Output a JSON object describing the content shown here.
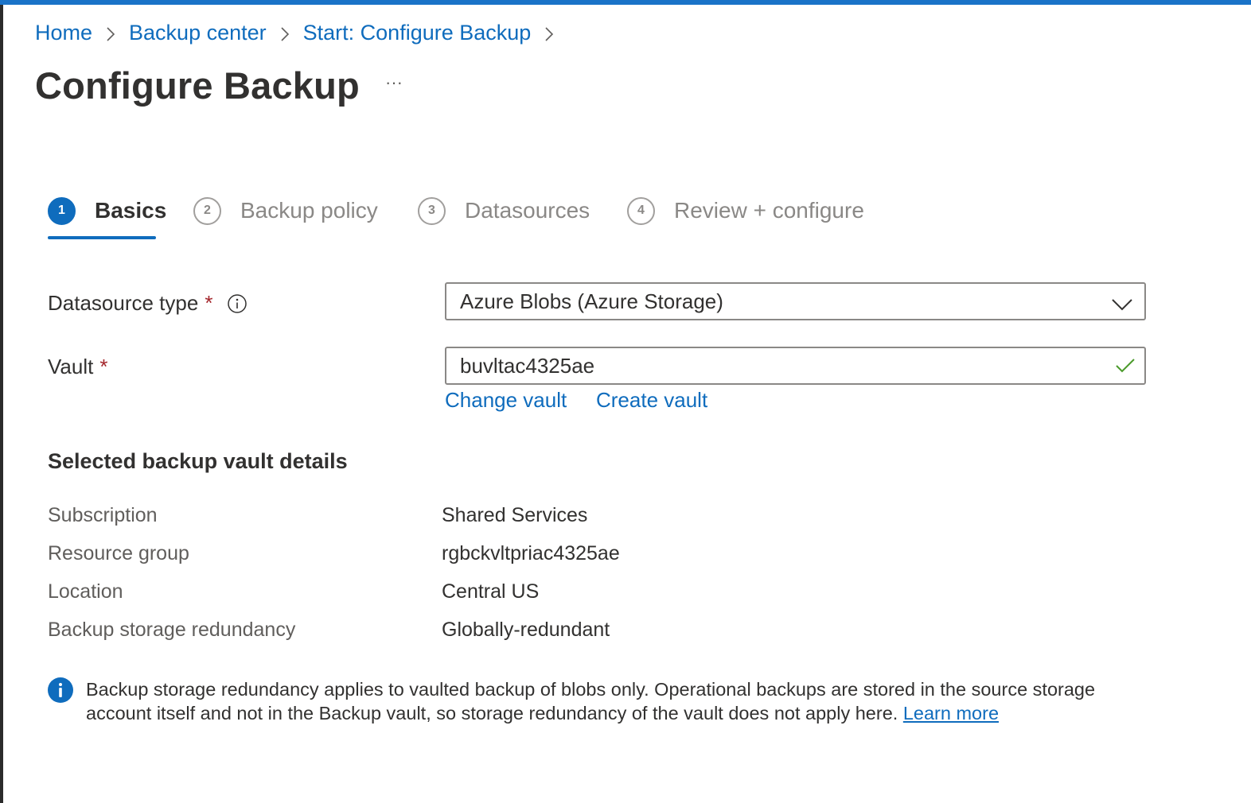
{
  "breadcrumb": {
    "items": [
      "Home",
      "Backup center",
      "Start: Configure Backup"
    ]
  },
  "page": {
    "title": "Configure Backup",
    "more_label": "···"
  },
  "tabs": [
    {
      "number": "1",
      "label": "Basics",
      "active": true
    },
    {
      "number": "2",
      "label": "Backup policy",
      "active": false
    },
    {
      "number": "3",
      "label": "Datasources",
      "active": false
    },
    {
      "number": "4",
      "label": "Review + configure",
      "active": false
    }
  ],
  "form": {
    "datasource_type": {
      "label": "Datasource type",
      "required_marker": "*",
      "value": "Azure Blobs (Azure Storage)"
    },
    "vault": {
      "label": "Vault",
      "required_marker": "*",
      "value": "buvltac4325ae",
      "change_link": "Change vault",
      "create_link": "Create vault"
    }
  },
  "details": {
    "heading": "Selected backup vault details",
    "rows": [
      {
        "label": "Subscription",
        "value": "Shared Services"
      },
      {
        "label": "Resource group",
        "value": "rgbckvltpriac4325ae"
      },
      {
        "label": "Location",
        "value": "Central US"
      },
      {
        "label": "Backup storage redundancy",
        "value": "Globally-redundant"
      }
    ]
  },
  "info_banner": {
    "text": "Backup storage redundancy applies to vaulted backup of blobs only. Operational backups are stored in the source storage account itself and not in the Backup vault, so storage redundancy of the vault does not apply here.",
    "link": "Learn more"
  },
  "icons": {
    "breadcrumb_separator": "chevron-right-icon",
    "dropdown": "chevron-down-icon",
    "valid": "checkmark-icon",
    "info": "info-icon"
  },
  "colors": {
    "accent": "#0f6cbd",
    "top_bar": "#1a73c8",
    "required": "#a4262c",
    "success": "#4a9a2a"
  }
}
